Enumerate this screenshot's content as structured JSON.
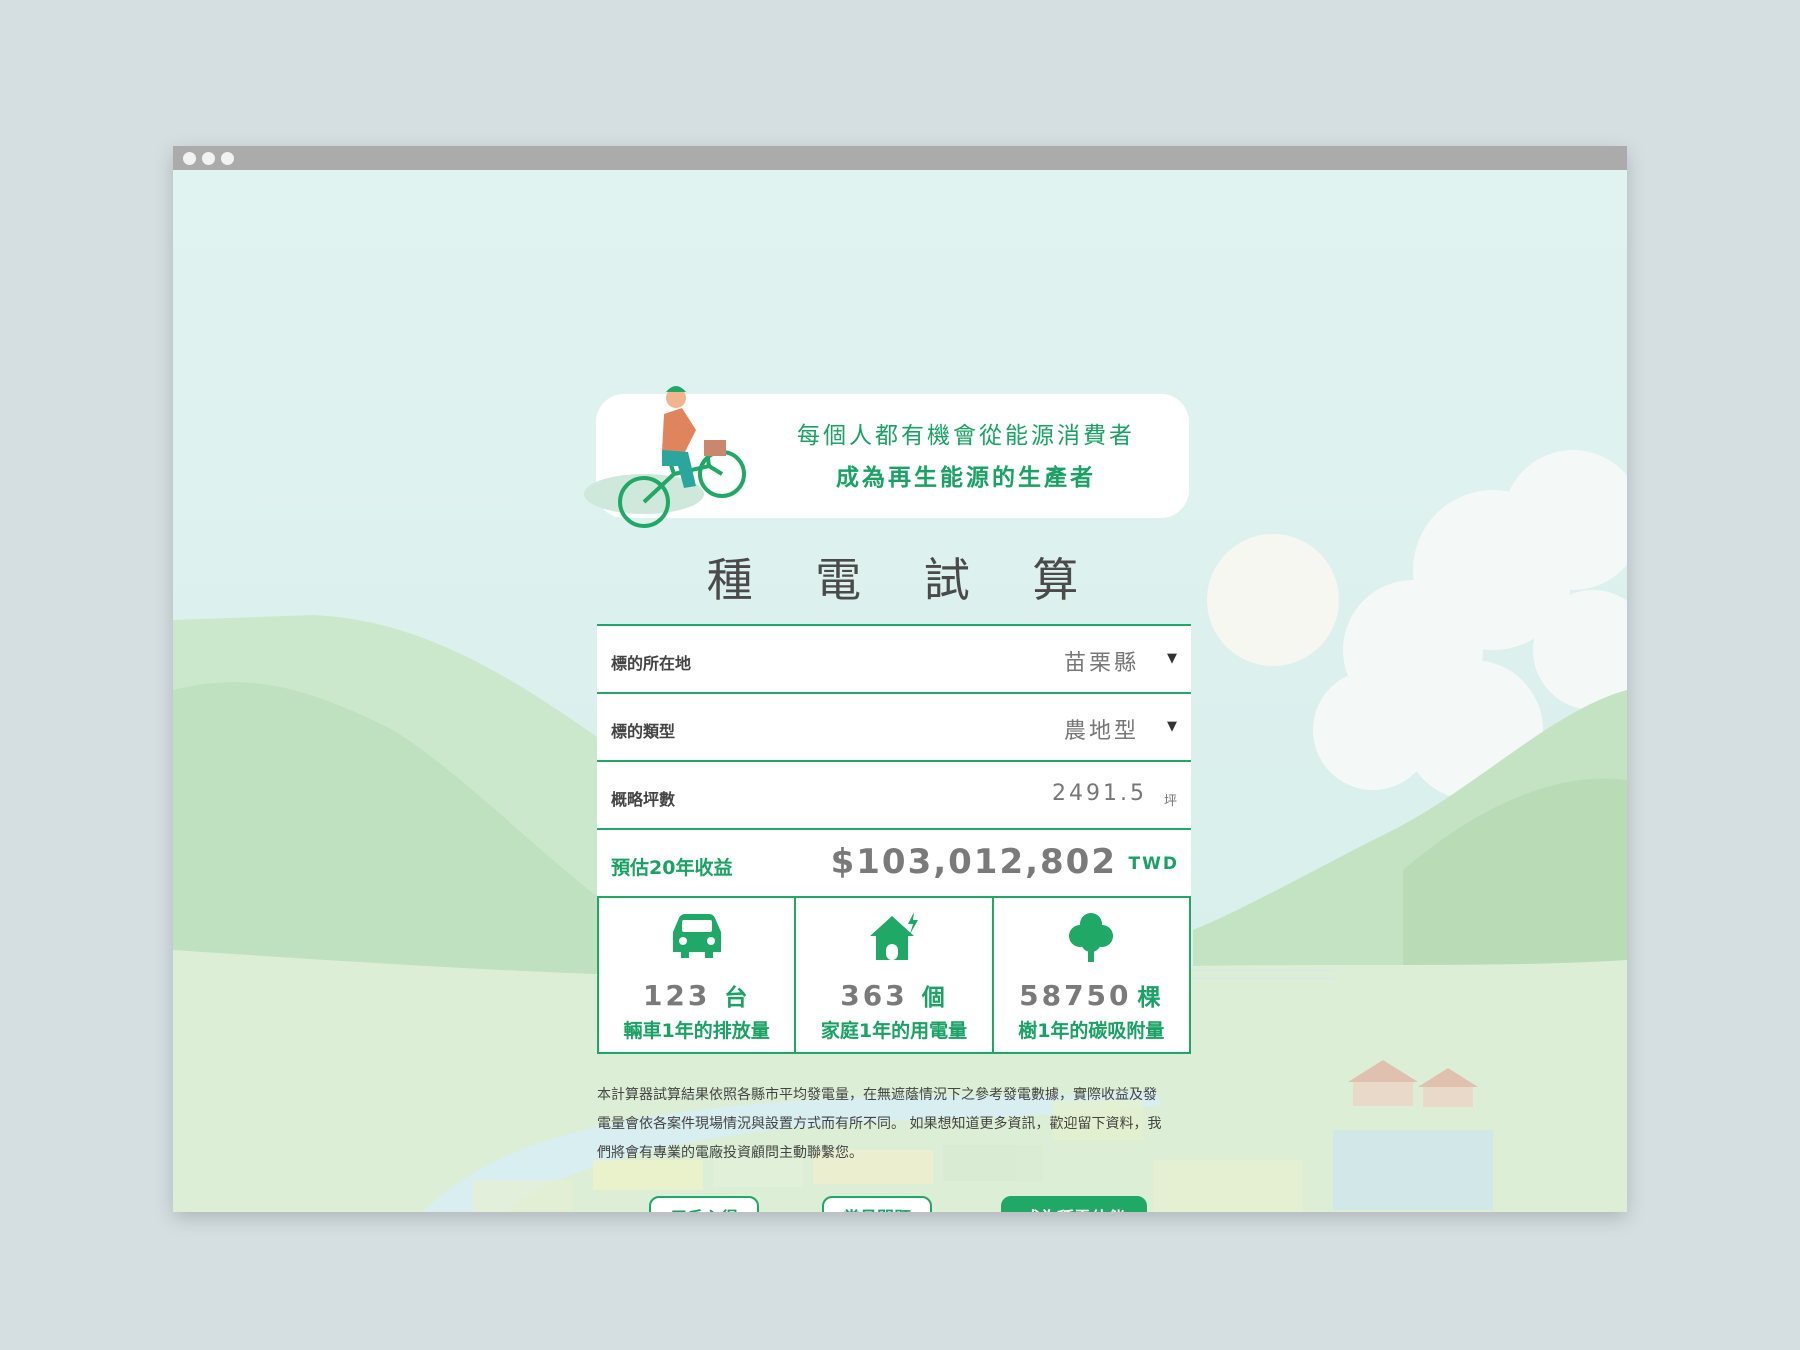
{
  "header": {
    "slogan_line1": "每個人都有機會從能源消費者",
    "slogan_line2": "成為再生能源的生產者"
  },
  "title": "種 電 試 算",
  "form": {
    "location": {
      "label": "標的所在地",
      "value": "苗栗縣",
      "caret": "▼"
    },
    "type": {
      "label": "標的類型",
      "value": "農地型",
      "caret": "▼"
    },
    "area": {
      "label": "概略坪數",
      "value": "2491.5",
      "unit": "坪"
    },
    "estimate": {
      "label": "預估20年收益",
      "value": "$103,012,802",
      "unit": "TWD"
    }
  },
  "stats": [
    {
      "icon": "car-icon",
      "value": "123",
      "unit": "台",
      "desc": "輛車1年的排放量"
    },
    {
      "icon": "house-electric-icon",
      "value": "363",
      "unit": "個",
      "desc": "家庭1年的用電量"
    },
    {
      "icon": "tree-icon",
      "value": "58750",
      "unit": "棵",
      "desc": "樹1年的碳吸附量"
    }
  ],
  "note": {
    "line1": "本計算器試算結果依照各縣市平均發電量，在無遮蔭情況下之參考發電數據，實際收益及發",
    "line2": "電量會依各案件現場情況與設置方式而有所不同。 如果想知道更多資訊，歡迎留下資料，我",
    "line3": "們將會有專業的電廠投資顧問主動聯繫您。"
  },
  "buttons": {
    "testimonials": "用戶心得",
    "faq": "常見問題",
    "partner": "成為種電伙伴"
  },
  "colors": {
    "accent": "#1fa866",
    "text_gray": "#7a7a7a",
    "backdrop": "#d5dfe2"
  }
}
